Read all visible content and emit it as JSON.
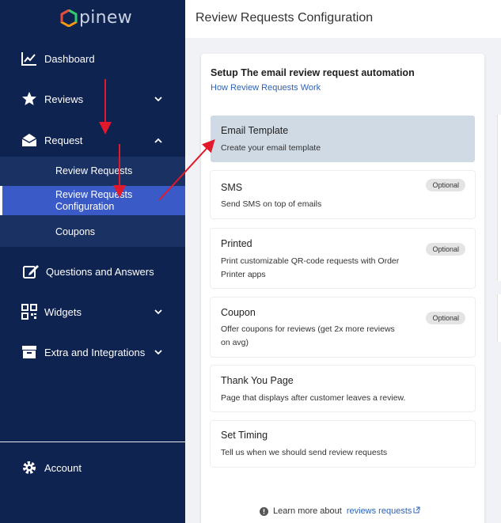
{
  "app": {
    "logo_text": "pinew"
  },
  "sidebar": {
    "items": [
      {
        "label": "Dashboard",
        "icon": "chart-line-icon"
      },
      {
        "label": "Reviews",
        "icon": "star-icon"
      },
      {
        "label": "Request",
        "icon": "envelope-open-icon"
      },
      {
        "label": "Questions and Answers",
        "icon": "edit-icon"
      },
      {
        "label": "Widgets",
        "icon": "qr-code-icon"
      },
      {
        "label": "Extra and Integrations",
        "icon": "archive-icon"
      },
      {
        "label": "Account",
        "icon": "gear-icon"
      }
    ],
    "submenu": [
      {
        "label": "Review Requests"
      },
      {
        "label": "Review Requests Configuration",
        "active": true
      },
      {
        "label": "Coupons"
      }
    ]
  },
  "header": {
    "title": "Review Requests Configuration"
  },
  "main": {
    "title": "Setup The email review request automation",
    "link": "How Review Requests Work",
    "steps": [
      {
        "title": "Email Template",
        "desc": "Create your email template",
        "badge": "",
        "selected": true
      },
      {
        "title": "SMS",
        "desc": "Send SMS on top of emails",
        "badge": "Optional"
      },
      {
        "title": "Printed",
        "desc": "Print customizable QR-code requests with Order Printer apps",
        "badge": "Optional"
      },
      {
        "title": "Coupon",
        "desc": "Offer coupons for reviews (get 2x more reviews on avg)",
        "badge": "Optional"
      },
      {
        "title": "Thank You Page",
        "desc": "Page that displays after customer leaves a review.",
        "badge": ""
      },
      {
        "title": "Set Timing",
        "desc": "Tell us when we should send review requests",
        "badge": ""
      }
    ],
    "learn_more": {
      "prefix": "Learn more about",
      "link": "reviews requests"
    }
  },
  "colors": {
    "sidebar_bg": "#0f2350",
    "active_item": "#3a5bc7",
    "link": "#2d63b8",
    "annotation_arrow": "#e0192b"
  }
}
